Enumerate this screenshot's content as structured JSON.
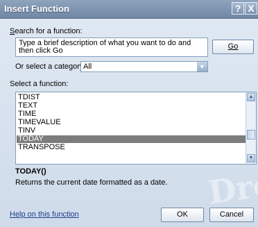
{
  "window": {
    "title": "Insert Function",
    "help_glyph": "?",
    "close_glyph": "X"
  },
  "search": {
    "label": "Search for a function:",
    "value": "Type a brief description of what you want to do and then click Go",
    "go_button": "Go"
  },
  "category": {
    "label": "Or select a category:",
    "selected": "All"
  },
  "functions": {
    "label": "Select a function:",
    "items": [
      "TDIST",
      "TEXT",
      "TIME",
      "TIMEVALUE",
      "TINV",
      "TODAY",
      "TRANSPOSE"
    ],
    "selected": "TODAY"
  },
  "details": {
    "signature": "TODAY()",
    "description": "Returns the current date formatted as a date."
  },
  "watermark": "Drop",
  "footer": {
    "help_link": "Help on this function",
    "ok": "OK",
    "cancel": "Cancel"
  }
}
